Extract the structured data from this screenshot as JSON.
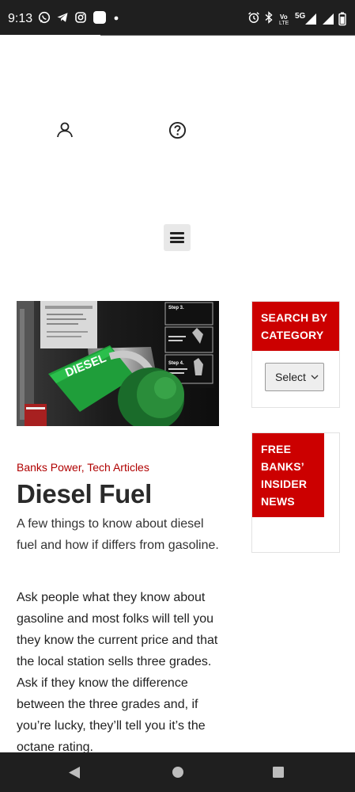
{
  "status_bar": {
    "time": "9:13",
    "network_labels": {
      "volte_top": "Vo",
      "volte_bottom": "LTE",
      "generation": "5G"
    },
    "icons": [
      "whatsapp-icon",
      "telegram-icon",
      "instagram-icon",
      "app-icon",
      "dot-icon",
      "alarm-icon",
      "bluetooth-icon",
      "volte-icon",
      "signal-icon",
      "signal-icon",
      "battery-icon"
    ]
  },
  "header": {
    "icons": [
      "account-icon",
      "help-icon"
    ],
    "menu_icon": "hamburger-menu-icon"
  },
  "article": {
    "hero_image": {
      "pump_label": "DIESEL",
      "step_labels": [
        "Step 3.",
        "Step 4."
      ]
    },
    "categories": [
      "Banks Power",
      "Tech Articles"
    ],
    "category_separator": ", ",
    "title": "Diesel Fuel",
    "subtitle": "A few things to know about diesel fuel and how if differs from gasoline.",
    "body": "Ask people what they know about gasoline and most folks will tell you they know the current price and that the local station sells three grades. Ask if they know the difference between the three grades and, if you’re lucky, they’ll tell you it’s the octane rating."
  },
  "sidebar": {
    "search_widget": {
      "title": "SEARCH BY CATEGORY",
      "select_value": "Select"
    },
    "news_widget": {
      "title": "FREE BANKS’ INSIDER NEWS"
    }
  },
  "nav_bar": {
    "icons": [
      "back-icon",
      "home-icon",
      "recents-icon"
    ]
  },
  "colors": {
    "accent_red": "#cc0000",
    "category_red": "#b00000",
    "status_bar_bg": "#1f1f1f",
    "pump_green": "#1f9e3a"
  }
}
